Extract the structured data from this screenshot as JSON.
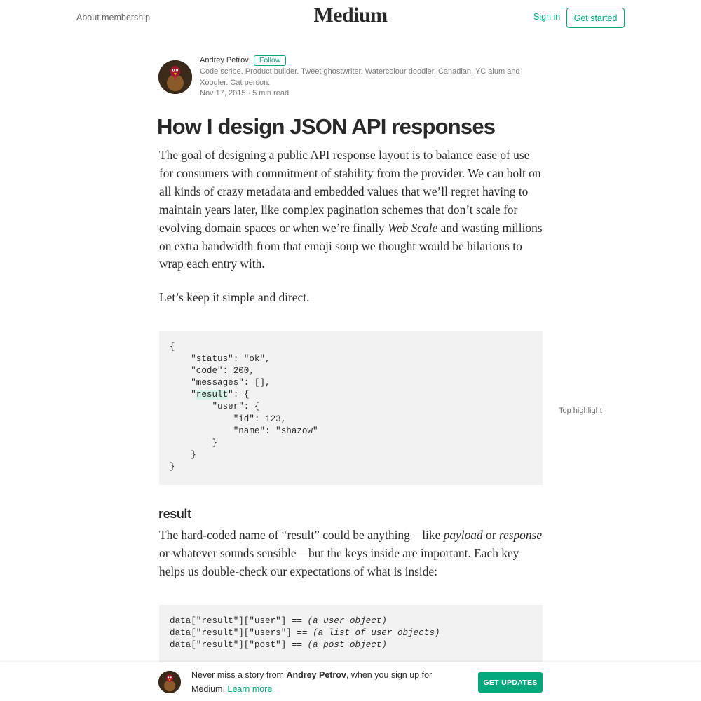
{
  "header": {
    "about_label": "About membership",
    "logo": "Medium",
    "signin_label": "Sign in",
    "get_started_label": "Get started"
  },
  "author": {
    "name": "Andrey Petrov",
    "follow_label": "Follow",
    "bio": "Code scribe. Product builder. Tweet ghostwriter. Watercolour doodler. Canadian. YC alum and Xoogler. Cat person.",
    "date": "Nov 17, 2015",
    "separator": "·",
    "read_time": "5 min read"
  },
  "article": {
    "title": "How I design JSON API responses",
    "p1_before": "The goal of designing a public API response layout is to balance ease of use for consumers with commitment of stability from the provider. We can bolt on all kinds of crazy metadata and embedded values that we’ll regret having to maintain years later, like complex pagination schemes that don’t scale for evolving domain spaces or when we’re finally ",
    "p1_em": "Web Scale",
    "p1_after": " and wasting millions on extra bandwidth from that emoji soup we thought would be hilarious to wrap each entry with.",
    "p2": "Let’s keep it simple and direct.",
    "code1": {
      "line1": "{",
      "line2": "    \"status\": \"ok\",",
      "line3": "    \"code\": 200,",
      "line4": "    \"messages\": [],",
      "line5_pre": "    \"",
      "line5_hl": "result",
      "line5_post": "\": {",
      "line6": "        \"user\": {",
      "line7": "            \"id\": 123,",
      "line8": "            \"name\": \"shazow\"",
      "line9": "        }",
      "line10": "    }",
      "line11": "}"
    },
    "top_highlight": "Top highlight",
    "h3": "result",
    "p3_before": "The hard-coded name of “result” could be anything—like ",
    "p3_em1": "payload",
    "p3_mid": " or ",
    "p3_em2": "response",
    "p3_after": " or whatever sounds sensible—but the keys inside are important. Each key helps us double-check our expectations of what is inside:",
    "code2": {
      "line1_code": "data[\"result\"][\"user\"] == ",
      "line1_comment": "(a user object)",
      "line2_code": "data[\"result\"][\"users\"] == ",
      "line2_comment": "(a list of user objects)",
      "line3_code": "data[\"result\"][\"post\"] == ",
      "line3_comment": "(a post object)"
    }
  },
  "banner": {
    "text_before": "Never miss a story from ",
    "author": "Andrey Petrov",
    "text_after": ", when you sign up for Medium. ",
    "learn_more": "Learn more",
    "button_label": "GET UPDATES"
  },
  "colors": {
    "accent": "#03a87c",
    "code_bg": "#f2f2f2",
    "highlight": "#d6f1e6"
  }
}
